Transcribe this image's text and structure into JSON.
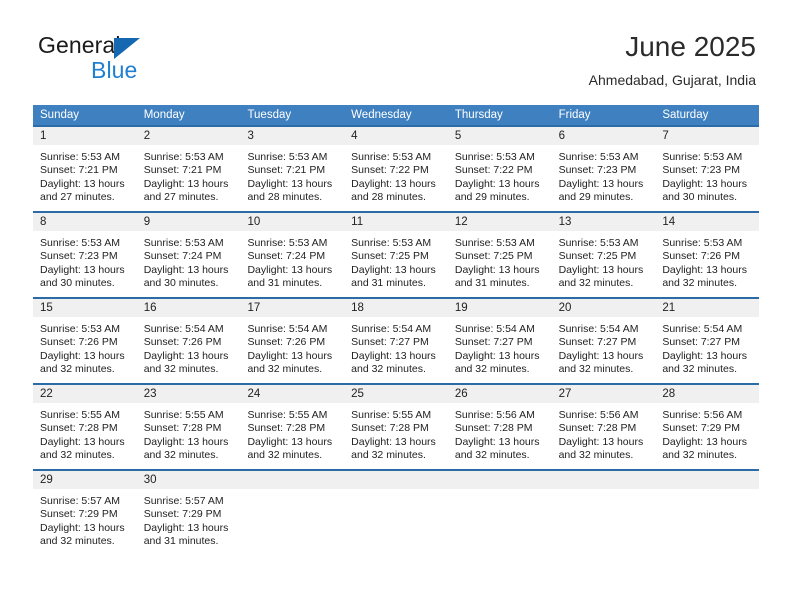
{
  "brand": {
    "name_part1": "General",
    "name_part2": "Blue",
    "triangle_icon": "brand-triangle-icon",
    "colors": {
      "general": "#1a1a1a",
      "blue": "#1f7fd0",
      "triangle": "#1568b0"
    }
  },
  "header": {
    "month_title": "June 2025",
    "location": "Ahmedabad, Gujarat, India"
  },
  "theme": {
    "header_row_bg": "#3f80c0",
    "day_strip_bg": "#f0f0f0",
    "day_strip_border": "#2b6ca8",
    "page_bg": "#ffffff",
    "text": "#222222"
  },
  "weekdays": [
    "Sunday",
    "Monday",
    "Tuesday",
    "Wednesday",
    "Thursday",
    "Friday",
    "Saturday"
  ],
  "weeks": [
    [
      {
        "day": "1",
        "sunrise": "Sunrise: 5:53 AM",
        "sunset": "Sunset: 7:21 PM",
        "daylight1": "Daylight: 13 hours",
        "daylight2": "and 27 minutes."
      },
      {
        "day": "2",
        "sunrise": "Sunrise: 5:53 AM",
        "sunset": "Sunset: 7:21 PM",
        "daylight1": "Daylight: 13 hours",
        "daylight2": "and 27 minutes."
      },
      {
        "day": "3",
        "sunrise": "Sunrise: 5:53 AM",
        "sunset": "Sunset: 7:21 PM",
        "daylight1": "Daylight: 13 hours",
        "daylight2": "and 28 minutes."
      },
      {
        "day": "4",
        "sunrise": "Sunrise: 5:53 AM",
        "sunset": "Sunset: 7:22 PM",
        "daylight1": "Daylight: 13 hours",
        "daylight2": "and 28 minutes."
      },
      {
        "day": "5",
        "sunrise": "Sunrise: 5:53 AM",
        "sunset": "Sunset: 7:22 PM",
        "daylight1": "Daylight: 13 hours",
        "daylight2": "and 29 minutes."
      },
      {
        "day": "6",
        "sunrise": "Sunrise: 5:53 AM",
        "sunset": "Sunset: 7:23 PM",
        "daylight1": "Daylight: 13 hours",
        "daylight2": "and 29 minutes."
      },
      {
        "day": "7",
        "sunrise": "Sunrise: 5:53 AM",
        "sunset": "Sunset: 7:23 PM",
        "daylight1": "Daylight: 13 hours",
        "daylight2": "and 30 minutes."
      }
    ],
    [
      {
        "day": "8",
        "sunrise": "Sunrise: 5:53 AM",
        "sunset": "Sunset: 7:23 PM",
        "daylight1": "Daylight: 13 hours",
        "daylight2": "and 30 minutes."
      },
      {
        "day": "9",
        "sunrise": "Sunrise: 5:53 AM",
        "sunset": "Sunset: 7:24 PM",
        "daylight1": "Daylight: 13 hours",
        "daylight2": "and 30 minutes."
      },
      {
        "day": "10",
        "sunrise": "Sunrise: 5:53 AM",
        "sunset": "Sunset: 7:24 PM",
        "daylight1": "Daylight: 13 hours",
        "daylight2": "and 31 minutes."
      },
      {
        "day": "11",
        "sunrise": "Sunrise: 5:53 AM",
        "sunset": "Sunset: 7:25 PM",
        "daylight1": "Daylight: 13 hours",
        "daylight2": "and 31 minutes."
      },
      {
        "day": "12",
        "sunrise": "Sunrise: 5:53 AM",
        "sunset": "Sunset: 7:25 PM",
        "daylight1": "Daylight: 13 hours",
        "daylight2": "and 31 minutes."
      },
      {
        "day": "13",
        "sunrise": "Sunrise: 5:53 AM",
        "sunset": "Sunset: 7:25 PM",
        "daylight1": "Daylight: 13 hours",
        "daylight2": "and 32 minutes."
      },
      {
        "day": "14",
        "sunrise": "Sunrise: 5:53 AM",
        "sunset": "Sunset: 7:26 PM",
        "daylight1": "Daylight: 13 hours",
        "daylight2": "and 32 minutes."
      }
    ],
    [
      {
        "day": "15",
        "sunrise": "Sunrise: 5:53 AM",
        "sunset": "Sunset: 7:26 PM",
        "daylight1": "Daylight: 13 hours",
        "daylight2": "and 32 minutes."
      },
      {
        "day": "16",
        "sunrise": "Sunrise: 5:54 AM",
        "sunset": "Sunset: 7:26 PM",
        "daylight1": "Daylight: 13 hours",
        "daylight2": "and 32 minutes."
      },
      {
        "day": "17",
        "sunrise": "Sunrise: 5:54 AM",
        "sunset": "Sunset: 7:26 PM",
        "daylight1": "Daylight: 13 hours",
        "daylight2": "and 32 minutes."
      },
      {
        "day": "18",
        "sunrise": "Sunrise: 5:54 AM",
        "sunset": "Sunset: 7:27 PM",
        "daylight1": "Daylight: 13 hours",
        "daylight2": "and 32 minutes."
      },
      {
        "day": "19",
        "sunrise": "Sunrise: 5:54 AM",
        "sunset": "Sunset: 7:27 PM",
        "daylight1": "Daylight: 13 hours",
        "daylight2": "and 32 minutes."
      },
      {
        "day": "20",
        "sunrise": "Sunrise: 5:54 AM",
        "sunset": "Sunset: 7:27 PM",
        "daylight1": "Daylight: 13 hours",
        "daylight2": "and 32 minutes."
      },
      {
        "day": "21",
        "sunrise": "Sunrise: 5:54 AM",
        "sunset": "Sunset: 7:27 PM",
        "daylight1": "Daylight: 13 hours",
        "daylight2": "and 32 minutes."
      }
    ],
    [
      {
        "day": "22",
        "sunrise": "Sunrise: 5:55 AM",
        "sunset": "Sunset: 7:28 PM",
        "daylight1": "Daylight: 13 hours",
        "daylight2": "and 32 minutes."
      },
      {
        "day": "23",
        "sunrise": "Sunrise: 5:55 AM",
        "sunset": "Sunset: 7:28 PM",
        "daylight1": "Daylight: 13 hours",
        "daylight2": "and 32 minutes."
      },
      {
        "day": "24",
        "sunrise": "Sunrise: 5:55 AM",
        "sunset": "Sunset: 7:28 PM",
        "daylight1": "Daylight: 13 hours",
        "daylight2": "and 32 minutes."
      },
      {
        "day": "25",
        "sunrise": "Sunrise: 5:55 AM",
        "sunset": "Sunset: 7:28 PM",
        "daylight1": "Daylight: 13 hours",
        "daylight2": "and 32 minutes."
      },
      {
        "day": "26",
        "sunrise": "Sunrise: 5:56 AM",
        "sunset": "Sunset: 7:28 PM",
        "daylight1": "Daylight: 13 hours",
        "daylight2": "and 32 minutes."
      },
      {
        "day": "27",
        "sunrise": "Sunrise: 5:56 AM",
        "sunset": "Sunset: 7:28 PM",
        "daylight1": "Daylight: 13 hours",
        "daylight2": "and 32 minutes."
      },
      {
        "day": "28",
        "sunrise": "Sunrise: 5:56 AM",
        "sunset": "Sunset: 7:29 PM",
        "daylight1": "Daylight: 13 hours",
        "daylight2": "and 32 minutes."
      }
    ],
    [
      {
        "day": "29",
        "sunrise": "Sunrise: 5:57 AM",
        "sunset": "Sunset: 7:29 PM",
        "daylight1": "Daylight: 13 hours",
        "daylight2": "and 32 minutes."
      },
      {
        "day": "30",
        "sunrise": "Sunrise: 5:57 AM",
        "sunset": "Sunset: 7:29 PM",
        "daylight1": "Daylight: 13 hours",
        "daylight2": "and 31 minutes."
      },
      {
        "day": "",
        "sunrise": "",
        "sunset": "",
        "daylight1": "",
        "daylight2": ""
      },
      {
        "day": "",
        "sunrise": "",
        "sunset": "",
        "daylight1": "",
        "daylight2": ""
      },
      {
        "day": "",
        "sunrise": "",
        "sunset": "",
        "daylight1": "",
        "daylight2": ""
      },
      {
        "day": "",
        "sunrise": "",
        "sunset": "",
        "daylight1": "",
        "daylight2": ""
      },
      {
        "day": "",
        "sunrise": "",
        "sunset": "",
        "daylight1": "",
        "daylight2": ""
      }
    ]
  ]
}
